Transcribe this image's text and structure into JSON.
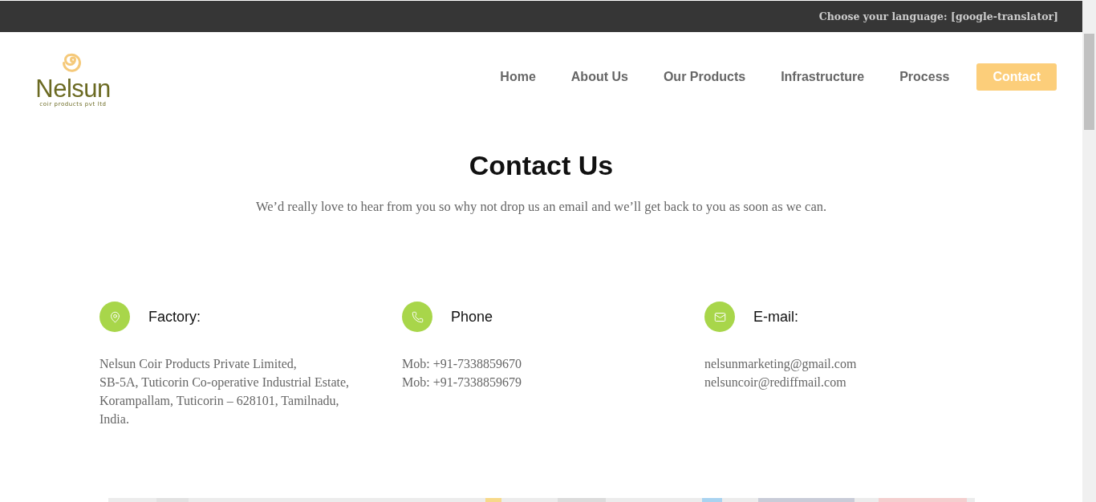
{
  "top_bar": {
    "language_text": "Choose your language: [google-translator]"
  },
  "logo": {
    "name": "Nelsun",
    "tagline": "coir products pvt ltd"
  },
  "nav": [
    {
      "label": "Home",
      "selected": false
    },
    {
      "label": "About Us",
      "selected": false
    },
    {
      "label": "Our Products",
      "selected": false
    },
    {
      "label": "Infrastructure",
      "selected": false
    },
    {
      "label": "Process",
      "selected": false
    },
    {
      "label": "Contact",
      "selected": true
    }
  ],
  "heading": "Contact Us",
  "intro": "We’d really love to hear from you so why not drop us an email and we’ll get back to you as soon as we can.",
  "contacts": [
    {
      "kind": "location",
      "title": "Factory:",
      "lines": [
        "Nelsun Coir Products Private Limited,",
        "SB-5A, Tuticorin Co-operative Industrial Estate,",
        "Korampallam, Tuticorin – 628101, Tamilnadu,",
        "India."
      ]
    },
    {
      "kind": "phone",
      "title": "Phone",
      "lines": [
        "Mob: +91-7338859670",
        "Mob: +91-7338859679"
      ]
    },
    {
      "kind": "email",
      "title": "E-mail:",
      "lines": [
        "nelsunmarketing@gmail.com",
        "nelsuncoir@rediffmail.com"
      ]
    }
  ]
}
